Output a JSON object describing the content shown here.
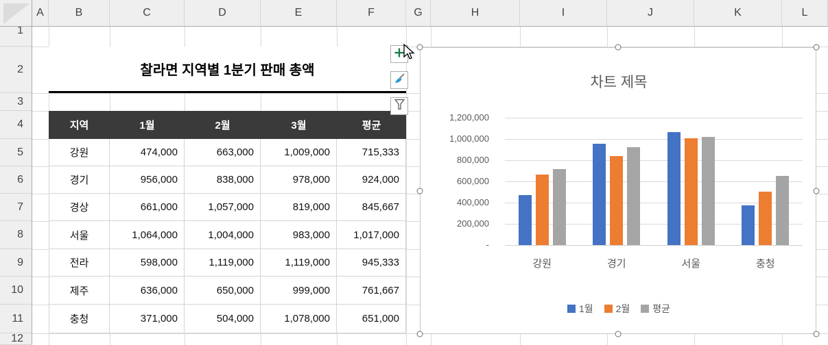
{
  "spreadsheet": {
    "column_headers": [
      "A",
      "B",
      "C",
      "D",
      "E",
      "F",
      "G",
      "H",
      "I",
      "J",
      "K",
      "L"
    ],
    "row_headers": [
      "1",
      "2",
      "3",
      "4",
      "5",
      "6",
      "7",
      "8",
      "9",
      "10",
      "11",
      "12"
    ]
  },
  "table": {
    "title": "찰라면 지역별 1분기 판매 총액",
    "columns": [
      "지역",
      "1월",
      "2월",
      "3월",
      "평균"
    ],
    "rows": [
      [
        "강원",
        "474,000",
        "663,000",
        "1,009,000",
        "715,333"
      ],
      [
        "경기",
        "956,000",
        "838,000",
        "978,000",
        "924,000"
      ],
      [
        "경상",
        "661,000",
        "1,057,000",
        "819,000",
        "845,667"
      ],
      [
        "서울",
        "1,064,000",
        "1,004,000",
        "983,000",
        "1,017,000"
      ],
      [
        "전라",
        "598,000",
        "1,119,000",
        "1,119,000",
        "945,333"
      ],
      [
        "제주",
        "636,000",
        "650,000",
        "999,000",
        "761,667"
      ],
      [
        "충청",
        "371,000",
        "504,000",
        "1,078,000",
        "651,000"
      ]
    ],
    "header_bg": "#3A3A3A",
    "header_text_color": "#FFFFFF"
  },
  "chart_tools": [
    {
      "label": "chart-elements",
      "icon": "plus-icon"
    },
    {
      "label": "chart-styles",
      "icon": "brush-icon"
    },
    {
      "label": "chart-filters",
      "icon": "funnel-icon"
    }
  ],
  "chart_data": {
    "type": "bar",
    "title": "차트 제목",
    "categories": [
      "강원",
      "경기",
      "서울",
      "충청"
    ],
    "series": [
      {
        "name": "1월",
        "color": "#4472C4",
        "values": [
          474000,
          956000,
          1064000,
          371000
        ]
      },
      {
        "name": "2월",
        "color": "#ED7D31",
        "values": [
          663000,
          838000,
          1004000,
          504000
        ]
      },
      {
        "name": "평균",
        "color": "#A5A5A5",
        "values": [
          715333,
          924000,
          1017000,
          651000
        ]
      }
    ],
    "ylim": [
      0,
      1200000
    ],
    "ytick_step": 200000,
    "ytick_labels": [
      "-",
      "200,000",
      "400,000",
      "600,000",
      "800,000",
      "1,000,000",
      "1,200,000"
    ],
    "grid": true,
    "legend_position": "bottom"
  }
}
